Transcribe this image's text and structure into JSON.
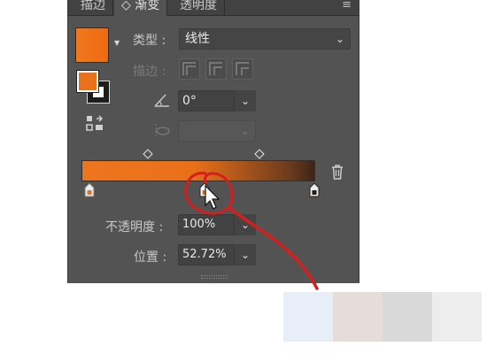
{
  "tabs": [
    {
      "label": "描边"
    },
    {
      "label": "◇ 渐变"
    },
    {
      "label": "透明度"
    }
  ],
  "panel_menu_icon": "hamburger-menu-icon",
  "type": {
    "label": "类型 :",
    "value": "线性"
  },
  "stroke": {
    "label": "描边 :"
  },
  "angle": {
    "value": "0°"
  },
  "opacity": {
    "label": "不透明度 :",
    "value": "100%"
  },
  "position": {
    "label": "位置 :",
    "value": "52.72%"
  },
  "gradient": {
    "start_color": "#ee7520",
    "end_color": "#3b2418",
    "selected_stop_position_pct": 52.72
  },
  "colors": {
    "panel_bg": "#535353",
    "accent_orange": "#e8711b",
    "annotation_red": "#d41f1f"
  },
  "palette": [
    "#e8eef7",
    "#e6ddd8",
    "#d9d9d9",
    "#ededed"
  ]
}
